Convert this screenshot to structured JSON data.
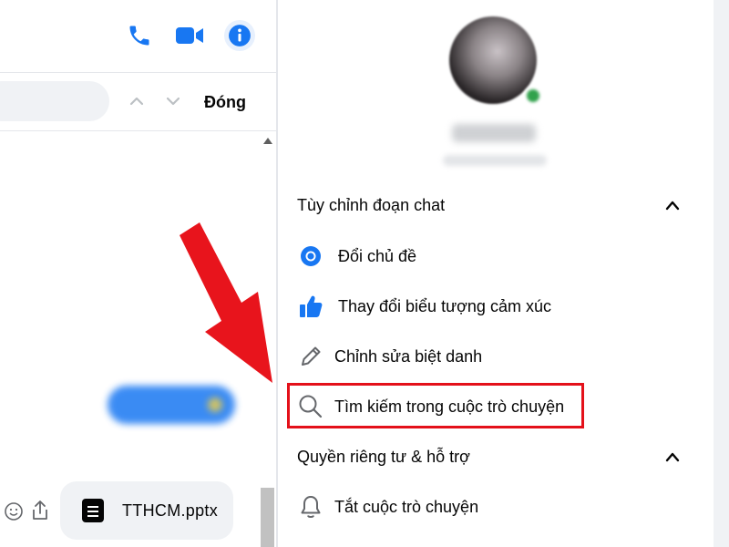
{
  "chat": {
    "close_label": "Đóng",
    "search_placeholder": "",
    "attachment": {
      "file_name": "TTHCM.pptx"
    }
  },
  "info_panel": {
    "customize_section": {
      "title": "Tùy chỉnh đoạn chat",
      "items": [
        {
          "label": "Đổi chủ đề",
          "icon": "theme-icon"
        },
        {
          "label": "Thay đổi biểu tượng cảm xúc",
          "icon": "thumbs-up-icon"
        },
        {
          "label": "Chỉnh sửa biệt danh",
          "icon": "pencil-icon"
        },
        {
          "label": "Tìm kiếm trong cuộc trò chuyện",
          "icon": "search-icon"
        }
      ]
    },
    "privacy_section": {
      "title": "Quyền riêng tư & hỗ trợ",
      "items": [
        {
          "label": "Tắt cuộc trò chuyện",
          "icon": "bell-icon"
        }
      ]
    }
  },
  "colors": {
    "accent": "#1877f2",
    "highlight": "#e4111a",
    "annotation_arrow": "#e8141c"
  }
}
